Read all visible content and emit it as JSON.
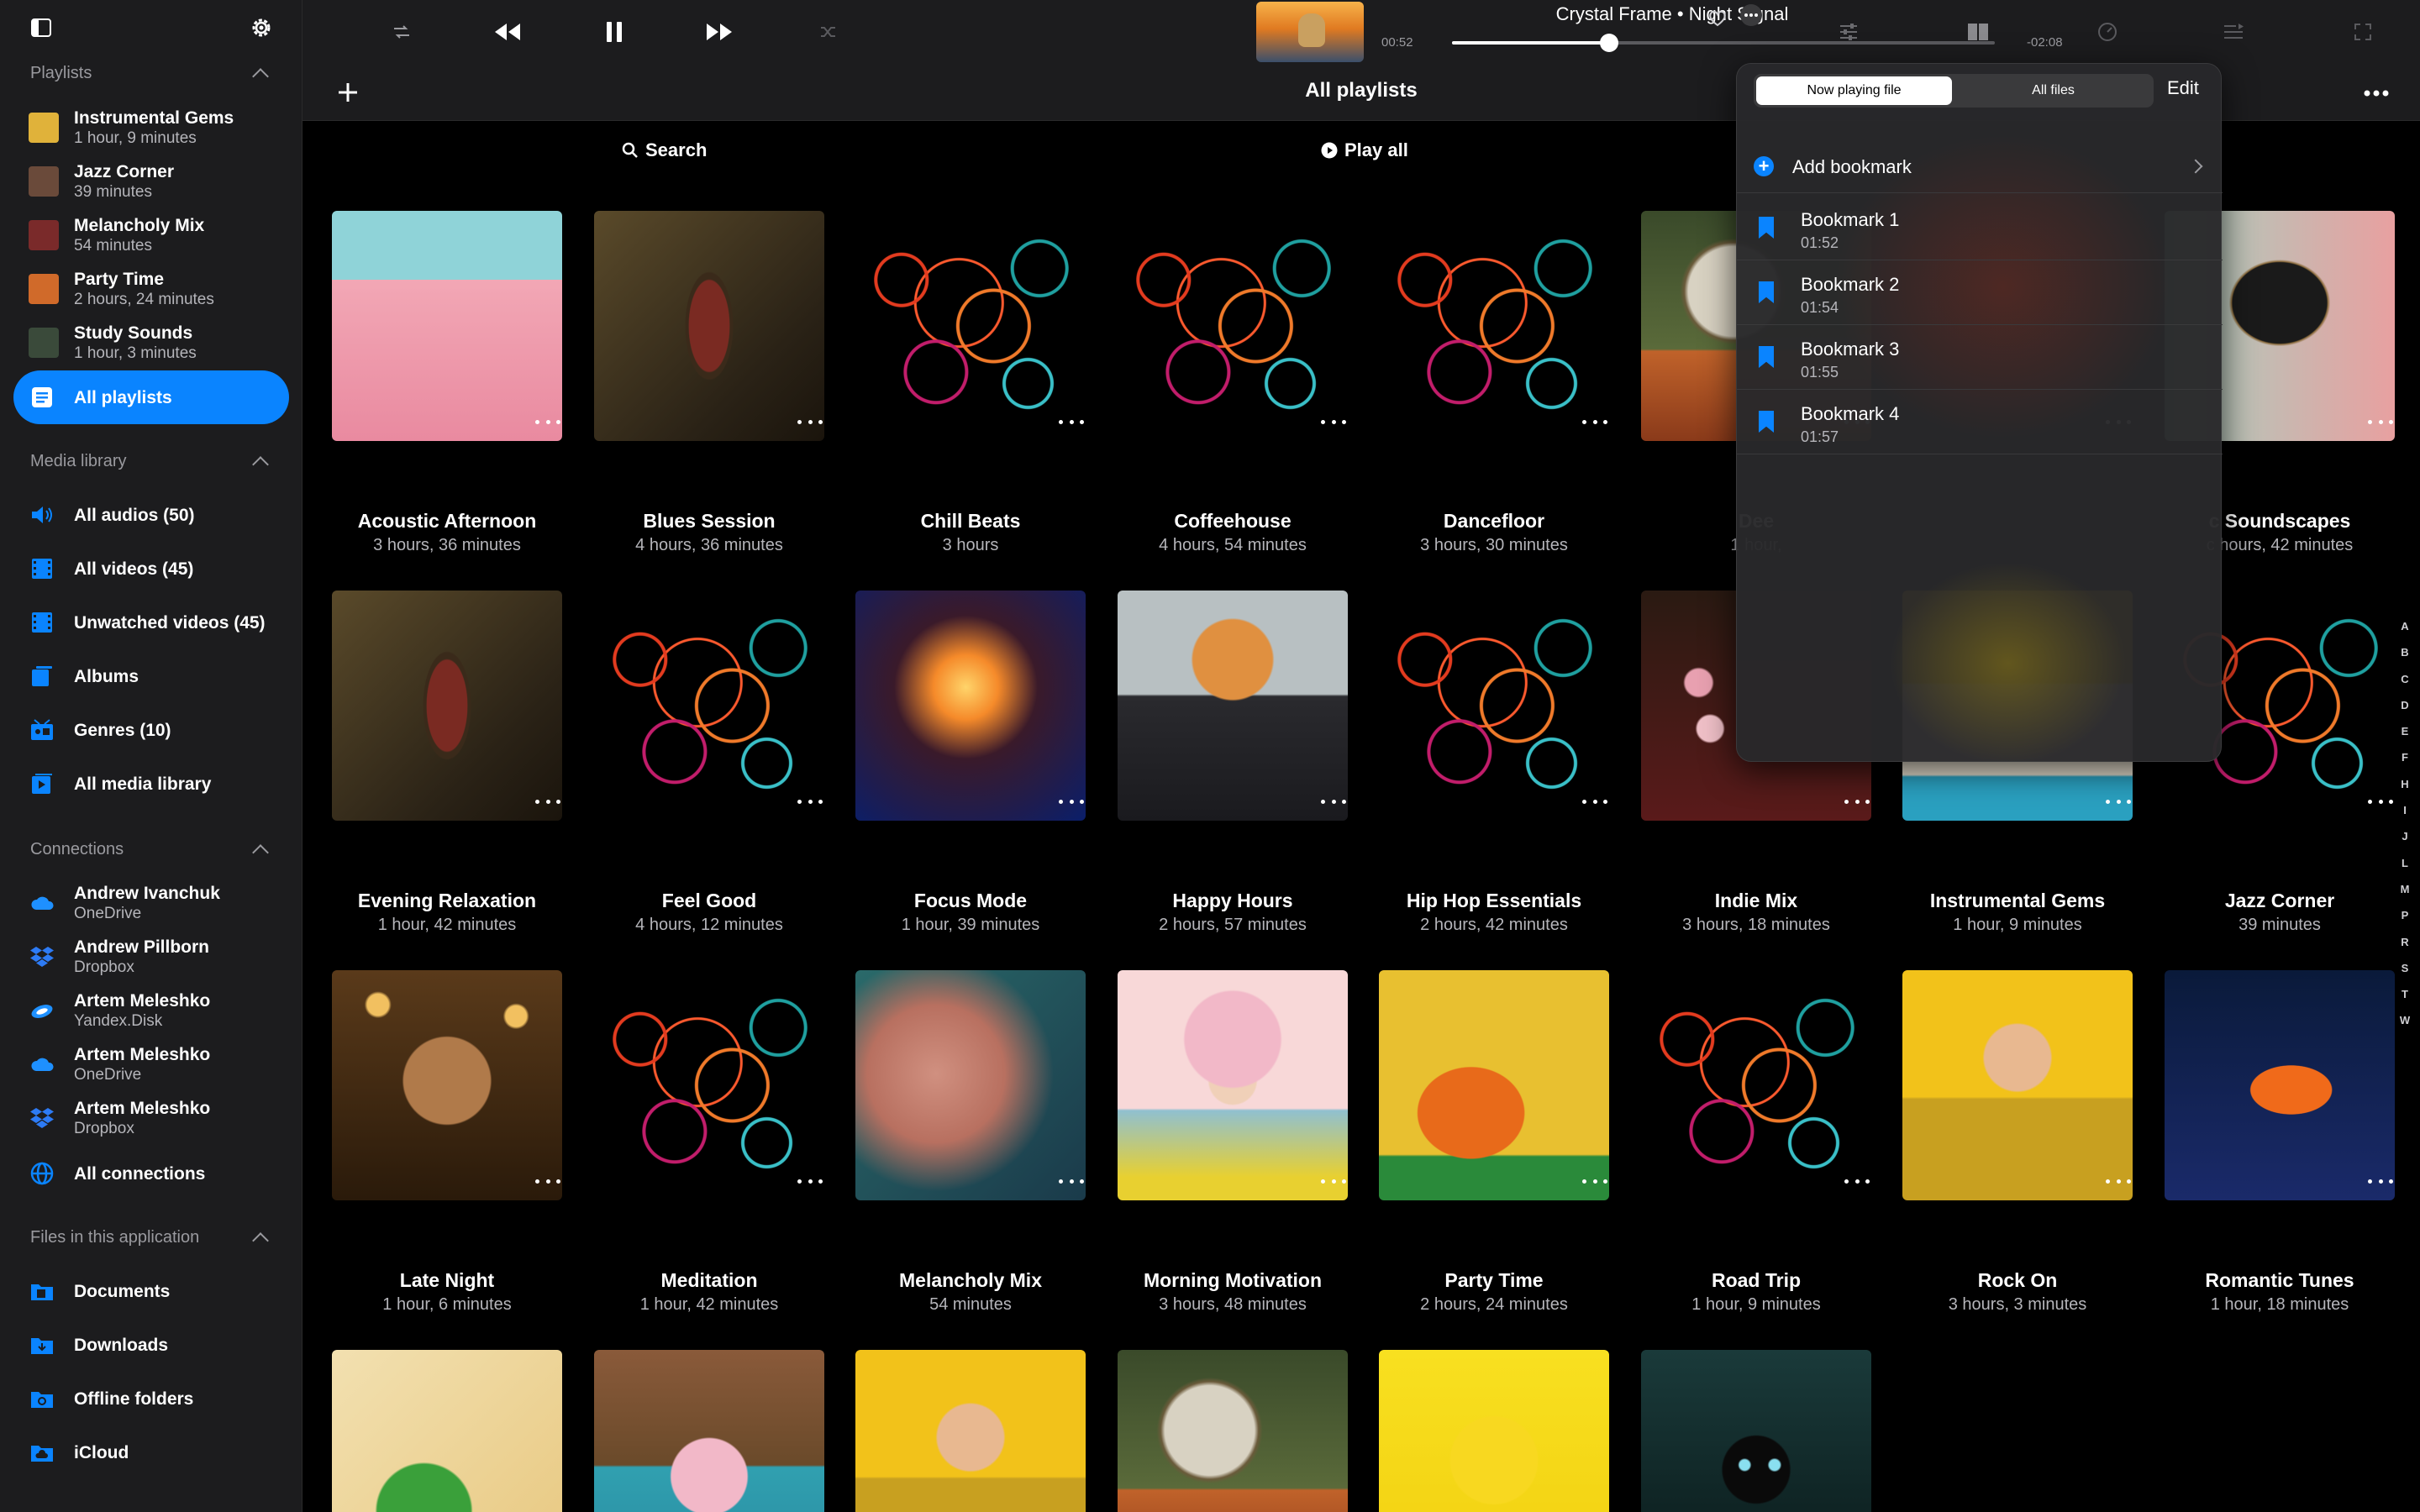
{
  "player": {
    "title": "Crystal Frame • Night Signal",
    "elapsed": "00:52",
    "remaining": "-02:08",
    "progress": 0.29
  },
  "sidebar": {
    "playlists_header": "Playlists",
    "playlists": [
      {
        "title": "Instrumental Gems",
        "sub": "1 hour, 9 minutes",
        "color": "#e0b23a"
      },
      {
        "title": "Jazz Corner",
        "sub": "39 minutes",
        "color": "#6a4a3a"
      },
      {
        "title": "Melancholy Mix",
        "sub": "54 minutes",
        "color": "#7a2a2a"
      },
      {
        "title": "Party Time",
        "sub": "2 hours, 24 minutes",
        "color": "#d06a2a"
      },
      {
        "title": "Study Sounds",
        "sub": "1 hour, 3 minutes",
        "color": "#3a4a3a"
      }
    ],
    "all_playlists": "All playlists",
    "media_header": "Media library",
    "media": [
      {
        "label": "All audios (50)",
        "icon": "speaker-icon"
      },
      {
        "label": "All videos (45)",
        "icon": "film-icon"
      },
      {
        "label": "Unwatched videos (45)",
        "icon": "film-icon"
      },
      {
        "label": "Albums",
        "icon": "albums-icon"
      },
      {
        "label": "Genres (10)",
        "icon": "genres-icon"
      },
      {
        "label": "All media library",
        "icon": "media-library-icon"
      }
    ],
    "connections_header": "Connections",
    "connections": [
      {
        "title": "Andrew Ivanchuk",
        "sub": "OneDrive",
        "icon": "onedrive-icon"
      },
      {
        "title": "Andrew Pillborn",
        "sub": "Dropbox",
        "icon": "dropbox-icon"
      },
      {
        "title": "Artem Meleshko",
        "sub": "Yandex.Disk",
        "icon": "yandex-disk-icon"
      },
      {
        "title": "Artem Meleshko",
        "sub": "OneDrive",
        "icon": "onedrive-icon"
      },
      {
        "title": "Artem Meleshko",
        "sub": "Dropbox",
        "icon": "dropbox-icon"
      }
    ],
    "all_connections": "All connections",
    "files_header": "Files in this application",
    "files": [
      {
        "label": "Documents",
        "icon": "documents-folder-icon"
      },
      {
        "label": "Downloads",
        "icon": "downloads-folder-icon"
      },
      {
        "label": "Offline folders",
        "icon": "offline-folder-icon"
      },
      {
        "label": "iCloud",
        "icon": "icloud-folder-icon"
      }
    ]
  },
  "header": {
    "title": "All playlists",
    "search": "Search",
    "play_all": "Play all"
  },
  "grid": [
    {
      "title": "Acoustic Afternoon",
      "sub": "3 hours, 36 minutes",
      "art": "pink"
    },
    {
      "title": "Blues Session",
      "sub": "4 hours, 36 minutes",
      "art": "switch"
    },
    {
      "title": "Chill Beats",
      "sub": "3 hours",
      "art": "swirl"
    },
    {
      "title": "Coffeehouse",
      "sub": "4 hours, 54 minutes",
      "art": "swirl"
    },
    {
      "title": "Dancefloor",
      "sub": "3 hours, 30 minutes",
      "art": "swirl"
    },
    {
      "title": "Dee",
      "sub": "1 hour,",
      "art": "astronaut"
    },
    {
      "title": "",
      "sub": "",
      "art": "hidden"
    },
    {
      "title": "c Soundscapes",
      "sub": "c hours, 42 minutes",
      "art": "robot"
    },
    {
      "title": "Evening Relaxation",
      "sub": "1 hour, 42 minutes",
      "art": "switch"
    },
    {
      "title": "Feel Good",
      "sub": "4 hours, 12 minutes",
      "art": "swirl"
    },
    {
      "title": "Focus Mode",
      "sub": "1 hour, 39 minutes",
      "art": "bulb"
    },
    {
      "title": "Happy Hours",
      "sub": "2 hours, 57 minutes",
      "art": "cat"
    },
    {
      "title": "Hip Hop Essentials",
      "sub": "2 hours, 42 minutes",
      "art": "swirl"
    },
    {
      "title": "Indie Mix",
      "sub": "3 hours, 18 minutes",
      "art": "flowers"
    },
    {
      "title": "Instrumental Gems",
      "sub": "1 hour, 9 minutes",
      "art": "doctor"
    },
    {
      "title": "Jazz Corner",
      "sub": "39 minutes",
      "art": "swirl"
    },
    {
      "title": "Late Night",
      "sub": "1 hour, 6 minutes",
      "art": "puppy"
    },
    {
      "title": "Meditation",
      "sub": "1 hour, 42 minutes",
      "art": "swirl"
    },
    {
      "title": "Melancholy Mix",
      "sub": "54 minutes",
      "art": "glitter"
    },
    {
      "title": "Morning Motivation",
      "sub": "3 hours, 48 minutes",
      "art": "girl"
    },
    {
      "title": "Party Time",
      "sub": "2 hours, 24 minutes",
      "art": "chair"
    },
    {
      "title": "Road Trip",
      "sub": "1 hour, 9 minutes",
      "art": "swirl"
    },
    {
      "title": "Rock On",
      "sub": "3 hours, 3 minutes",
      "art": "banana"
    },
    {
      "title": "Romantic Tunes",
      "sub": "1 hour, 18 minutes",
      "art": "frog"
    },
    {
      "title": "",
      "sub": "",
      "art": "pow"
    },
    {
      "title": "",
      "sub": "",
      "art": "car"
    },
    {
      "title": "",
      "sub": "",
      "art": "banana"
    },
    {
      "title": "",
      "sub": "",
      "art": "astronaut"
    },
    {
      "title": "",
      "sub": "",
      "art": "duck"
    },
    {
      "title": "",
      "sub": "",
      "art": "hood"
    }
  ],
  "alphabet": [
    "A",
    "B",
    "C",
    "D",
    "E",
    "F",
    "H",
    "I",
    "J",
    "L",
    "M",
    "P",
    "R",
    "S",
    "T",
    "W"
  ],
  "popover": {
    "tab_now": "Now playing file",
    "tab_all": "All files",
    "edit": "Edit",
    "add_bookmark": "Add bookmark",
    "bookmarks": [
      {
        "name": "Bookmark 1",
        "time": "01:52"
      },
      {
        "name": "Bookmark 2",
        "time": "01:54"
      },
      {
        "name": "Bookmark 3",
        "time": "01:55"
      },
      {
        "name": "Bookmark 4",
        "time": "01:57"
      }
    ]
  },
  "colors": {
    "accent": "#0a84ff",
    "sidebar_bg": "#1c1c1e",
    "background": "#000000"
  }
}
